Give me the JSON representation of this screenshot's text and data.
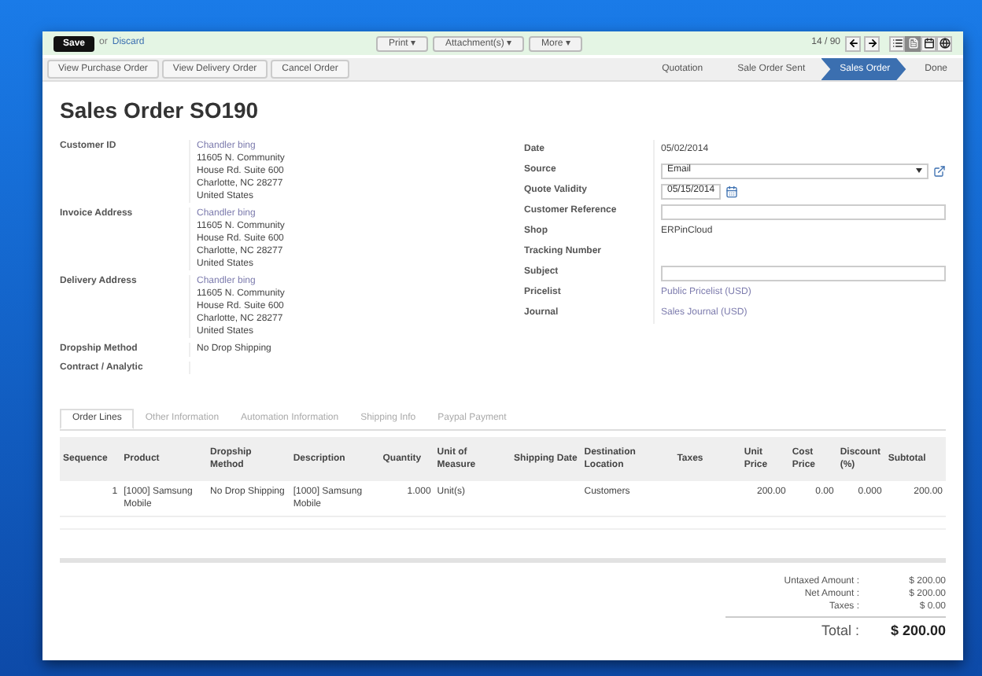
{
  "toolbar": {
    "save": "Save",
    "or": "or",
    "discard": "Discard",
    "menus": [
      {
        "label": "Print ▾"
      },
      {
        "label": "Attachment(s) ▾"
      },
      {
        "label": "More ▾"
      }
    ],
    "pager": "14 / 90",
    "views": [
      {
        "kind": "list",
        "selected": false
      },
      {
        "kind": "form",
        "selected": true
      },
      {
        "kind": "calendar",
        "selected": false
      },
      {
        "kind": "map",
        "selected": false
      }
    ]
  },
  "actions": [
    "View Purchase Order",
    "View Delivery Order",
    "Cancel Order"
  ],
  "stages": [
    {
      "label": "Quotation",
      "selected": false
    },
    {
      "label": "Sale Order Sent",
      "selected": false
    },
    {
      "label": "Sales Order",
      "selected": true
    },
    {
      "label": "Done",
      "selected": false
    }
  ],
  "title": "Sales Order SO190",
  "left_fields": [
    {
      "label": "Customer ID",
      "kind": "address",
      "link": "Chandler bing",
      "lines": [
        "11605 N. Community",
        "House Rd. Suite 600",
        "Charlotte, NC 28277",
        "United States"
      ]
    },
    {
      "label": "Invoice Address",
      "kind": "address",
      "link": "Chandler bing",
      "lines": [
        "11605 N. Community",
        "House Rd. Suite 600",
        "Charlotte, NC 28277",
        "United States"
      ]
    },
    {
      "label": "Delivery Address",
      "kind": "address",
      "link": "Chandler bing",
      "lines": [
        "11605 N. Community",
        "House Rd. Suite 600",
        "Charlotte, NC 28277",
        "United States"
      ]
    },
    {
      "label": "Dropship Method",
      "kind": "text",
      "value": "No Drop Shipping"
    },
    {
      "label": "Contract / Analytic",
      "kind": "empty"
    }
  ],
  "right_fields": [
    {
      "label": "Date",
      "kind": "text",
      "value": "05/02/2014"
    },
    {
      "label": "Source",
      "kind": "select",
      "value": "Email"
    },
    {
      "label": "Quote Validity",
      "kind": "date",
      "value": "05/15/2014"
    },
    {
      "label": "Customer Reference",
      "kind": "input"
    },
    {
      "label": "Shop",
      "kind": "text",
      "value": "ERPinCloud"
    },
    {
      "label": "Tracking Number",
      "kind": "empty"
    },
    {
      "label": "Subject",
      "kind": "input"
    },
    {
      "label": "Pricelist",
      "kind": "link",
      "value": "Public Pricelist (USD)"
    },
    {
      "label": "Journal",
      "kind": "link",
      "value": "Sales Journal (USD)"
    }
  ],
  "tabs": [
    {
      "label": "Order Lines",
      "selected": true
    },
    {
      "label": "Other Information",
      "selected": false
    },
    {
      "label": "Automation Information",
      "selected": false
    },
    {
      "label": "Shipping Info",
      "selected": false
    },
    {
      "label": "Paypal Payment",
      "selected": false
    }
  ],
  "table": {
    "columns": [
      "Sequence",
      "Product",
      "Dropship Method",
      "Description",
      "Quantity",
      "Unit of Measure",
      "Shipping Date",
      "Destination Location",
      "Taxes",
      "Unit Price",
      "Cost Price",
      "Discount (%)",
      "Subtotal"
    ],
    "rows": [
      {
        "cells": [
          "1",
          "[1000] Samsung Mobile",
          "No Drop Shipping",
          "[1000] Samsung Mobile",
          "1.000",
          "Unit(s)",
          "",
          "Customers",
          "",
          "200.00",
          "0.00",
          "0.000",
          "200.00"
        ]
      }
    ]
  },
  "totals": [
    {
      "label": "Untaxed Amount :",
      "value": "$ 200.00"
    },
    {
      "label": "Net Amount :",
      "value": "$ 200.00"
    },
    {
      "label": "Taxes :",
      "value": "$ 0.00"
    }
  ],
  "total": {
    "label": "Total :",
    "value": "$ 200.00"
  }
}
